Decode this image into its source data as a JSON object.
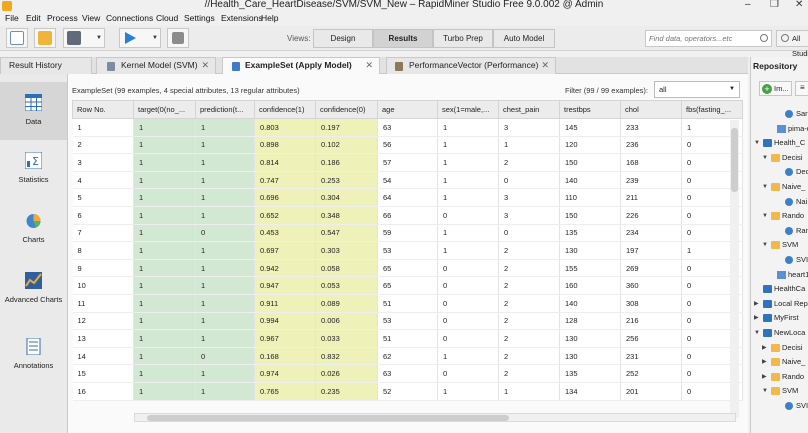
{
  "window": {
    "title": "//Health_Care_HeartDisease/SVM/SVM_New – RapidMiner Studio Free 9.0.002 @ Admin",
    "controls": [
      "–",
      "❐",
      "✕"
    ]
  },
  "menu": {
    "items": [
      "File",
      "Edit",
      "Process",
      "View",
      "Connections",
      "Cloud",
      "Settings",
      "Extensions",
      "Help"
    ]
  },
  "toolbar": {
    "views_label": "Views:",
    "views": [
      "Design",
      "Results",
      "Turbo Prep",
      "Auto Model"
    ],
    "active_view": "Results",
    "search_placeholder": "Find data, operators...etc",
    "studio_label": "All Studio"
  },
  "tabs": [
    {
      "label": "Result History",
      "active": false
    },
    {
      "label": "Kernel Model (SVM)",
      "active": false
    },
    {
      "label": "ExampleSet (Apply Model)",
      "active": true
    },
    {
      "label": "PerformanceVector (Performance)",
      "active": false
    }
  ],
  "nav": {
    "items": [
      {
        "label": "Data",
        "icon": "grid-icon",
        "active": true
      },
      {
        "label": "Statistics",
        "icon": "statistics-icon",
        "active": false
      },
      {
        "label": "Charts",
        "icon": "pie-chart-icon",
        "active": false
      },
      {
        "label": "Advanced Charts",
        "icon": "advanced-chart-icon",
        "active": false
      },
      {
        "label": "Annotations",
        "icon": "annotations-icon",
        "active": false
      }
    ]
  },
  "dataset": {
    "summary": "ExampleSet (99 examples, 4 special attributes, 13 regular attributes)",
    "filter_label": "Filter (99 / 99 examples):",
    "filter_value": "all",
    "columns": [
      "Row No.",
      "target(0(no_...",
      "prediction(t...",
      "confidence(1)",
      "confidence(0)",
      "age",
      "sex(1=male,...",
      "chest_pain",
      "trestbps",
      "chol",
      "fbs(fasting_..."
    ],
    "rows": [
      [
        "1",
        "1",
        "1",
        "0.803",
        "0.197",
        "63",
        "1",
        "3",
        "145",
        "233",
        "1"
      ],
      [
        "2",
        "1",
        "1",
        "0.898",
        "0.102",
        "56",
        "1",
        "1",
        "120",
        "236",
        "0"
      ],
      [
        "3",
        "1",
        "1",
        "0.814",
        "0.186",
        "57",
        "1",
        "2",
        "150",
        "168",
        "0"
      ],
      [
        "4",
        "1",
        "1",
        "0.747",
        "0.253",
        "54",
        "1",
        "0",
        "140",
        "239",
        "0"
      ],
      [
        "5",
        "1",
        "1",
        "0.696",
        "0.304",
        "64",
        "1",
        "3",
        "110",
        "211",
        "0"
      ],
      [
        "6",
        "1",
        "1",
        "0.652",
        "0.348",
        "66",
        "0",
        "3",
        "150",
        "226",
        "0"
      ],
      [
        "7",
        "1",
        "0",
        "0.453",
        "0.547",
        "59",
        "1",
        "0",
        "135",
        "234",
        "0"
      ],
      [
        "8",
        "1",
        "1",
        "0.697",
        "0.303",
        "53",
        "1",
        "2",
        "130",
        "197",
        "1"
      ],
      [
        "9",
        "1",
        "1",
        "0.942",
        "0.058",
        "65",
        "0",
        "2",
        "155",
        "269",
        "0"
      ],
      [
        "10",
        "1",
        "1",
        "0.947",
        "0.053",
        "65",
        "0",
        "2",
        "160",
        "360",
        "0"
      ],
      [
        "11",
        "1",
        "1",
        "0.911",
        "0.089",
        "51",
        "0",
        "2",
        "140",
        "308",
        "0"
      ],
      [
        "12",
        "1",
        "1",
        "0.994",
        "0.006",
        "53",
        "0",
        "2",
        "128",
        "216",
        "0"
      ],
      [
        "13",
        "1",
        "1",
        "0.967",
        "0.033",
        "51",
        "0",
        "2",
        "130",
        "256",
        "0"
      ],
      [
        "14",
        "1",
        "0",
        "0.168",
        "0.832",
        "62",
        "1",
        "2",
        "130",
        "231",
        "0"
      ],
      [
        "15",
        "1",
        "1",
        "0.974",
        "0.026",
        "63",
        "0",
        "2",
        "135",
        "252",
        "0"
      ],
      [
        "16",
        "1",
        "1",
        "0.765",
        "0.235",
        "52",
        "1",
        "1",
        "134",
        "201",
        "0"
      ]
    ]
  },
  "repository": {
    "title": "Repository",
    "import_label": "Im...",
    "menu_label": "≡",
    "tree": [
      {
        "label": "Sar",
        "type": "proc",
        "indent": 28,
        "twist": ""
      },
      {
        "label": "pima-d",
        "type": "data",
        "indent": 20,
        "twist": ""
      },
      {
        "label": "Health_C",
        "type": "db",
        "indent": 6,
        "twist": "▼"
      },
      {
        "label": "Decisi",
        "type": "folder",
        "indent": 14,
        "twist": "▼"
      },
      {
        "label": "Dec",
        "type": "proc",
        "indent": 28,
        "twist": ""
      },
      {
        "label": "Naive_",
        "type": "folder",
        "indent": 14,
        "twist": "▼"
      },
      {
        "label": "Nai",
        "type": "proc",
        "indent": 28,
        "twist": ""
      },
      {
        "label": "Rando",
        "type": "folder",
        "indent": 14,
        "twist": "▼"
      },
      {
        "label": "Ran",
        "type": "proc",
        "indent": 28,
        "twist": ""
      },
      {
        "label": "SVM",
        "type": "folder",
        "indent": 14,
        "twist": "▼"
      },
      {
        "label": "SVI",
        "type": "proc",
        "indent": 28,
        "twist": ""
      },
      {
        "label": "heart1",
        "type": "data",
        "indent": 20,
        "twist": ""
      },
      {
        "label": "HealthCa",
        "type": "db",
        "indent": 6,
        "twist": ""
      },
      {
        "label": "Local Rep",
        "type": "db",
        "indent": 6,
        "twist": "▶"
      },
      {
        "label": "MyFirst",
        "type": "db",
        "indent": 6,
        "twist": "▶"
      },
      {
        "label": "NewLoca",
        "type": "db",
        "indent": 6,
        "twist": "▼"
      },
      {
        "label": "Decisi",
        "type": "folder",
        "indent": 14,
        "twist": "▶"
      },
      {
        "label": "Naive_",
        "type": "folder",
        "indent": 14,
        "twist": "▶"
      },
      {
        "label": "Rando",
        "type": "folder",
        "indent": 14,
        "twist": "▶"
      },
      {
        "label": "SVM",
        "type": "folder",
        "indent": 14,
        "twist": "▼"
      },
      {
        "label": "SVI",
        "type": "proc",
        "indent": 28,
        "twist": ""
      }
    ]
  }
}
